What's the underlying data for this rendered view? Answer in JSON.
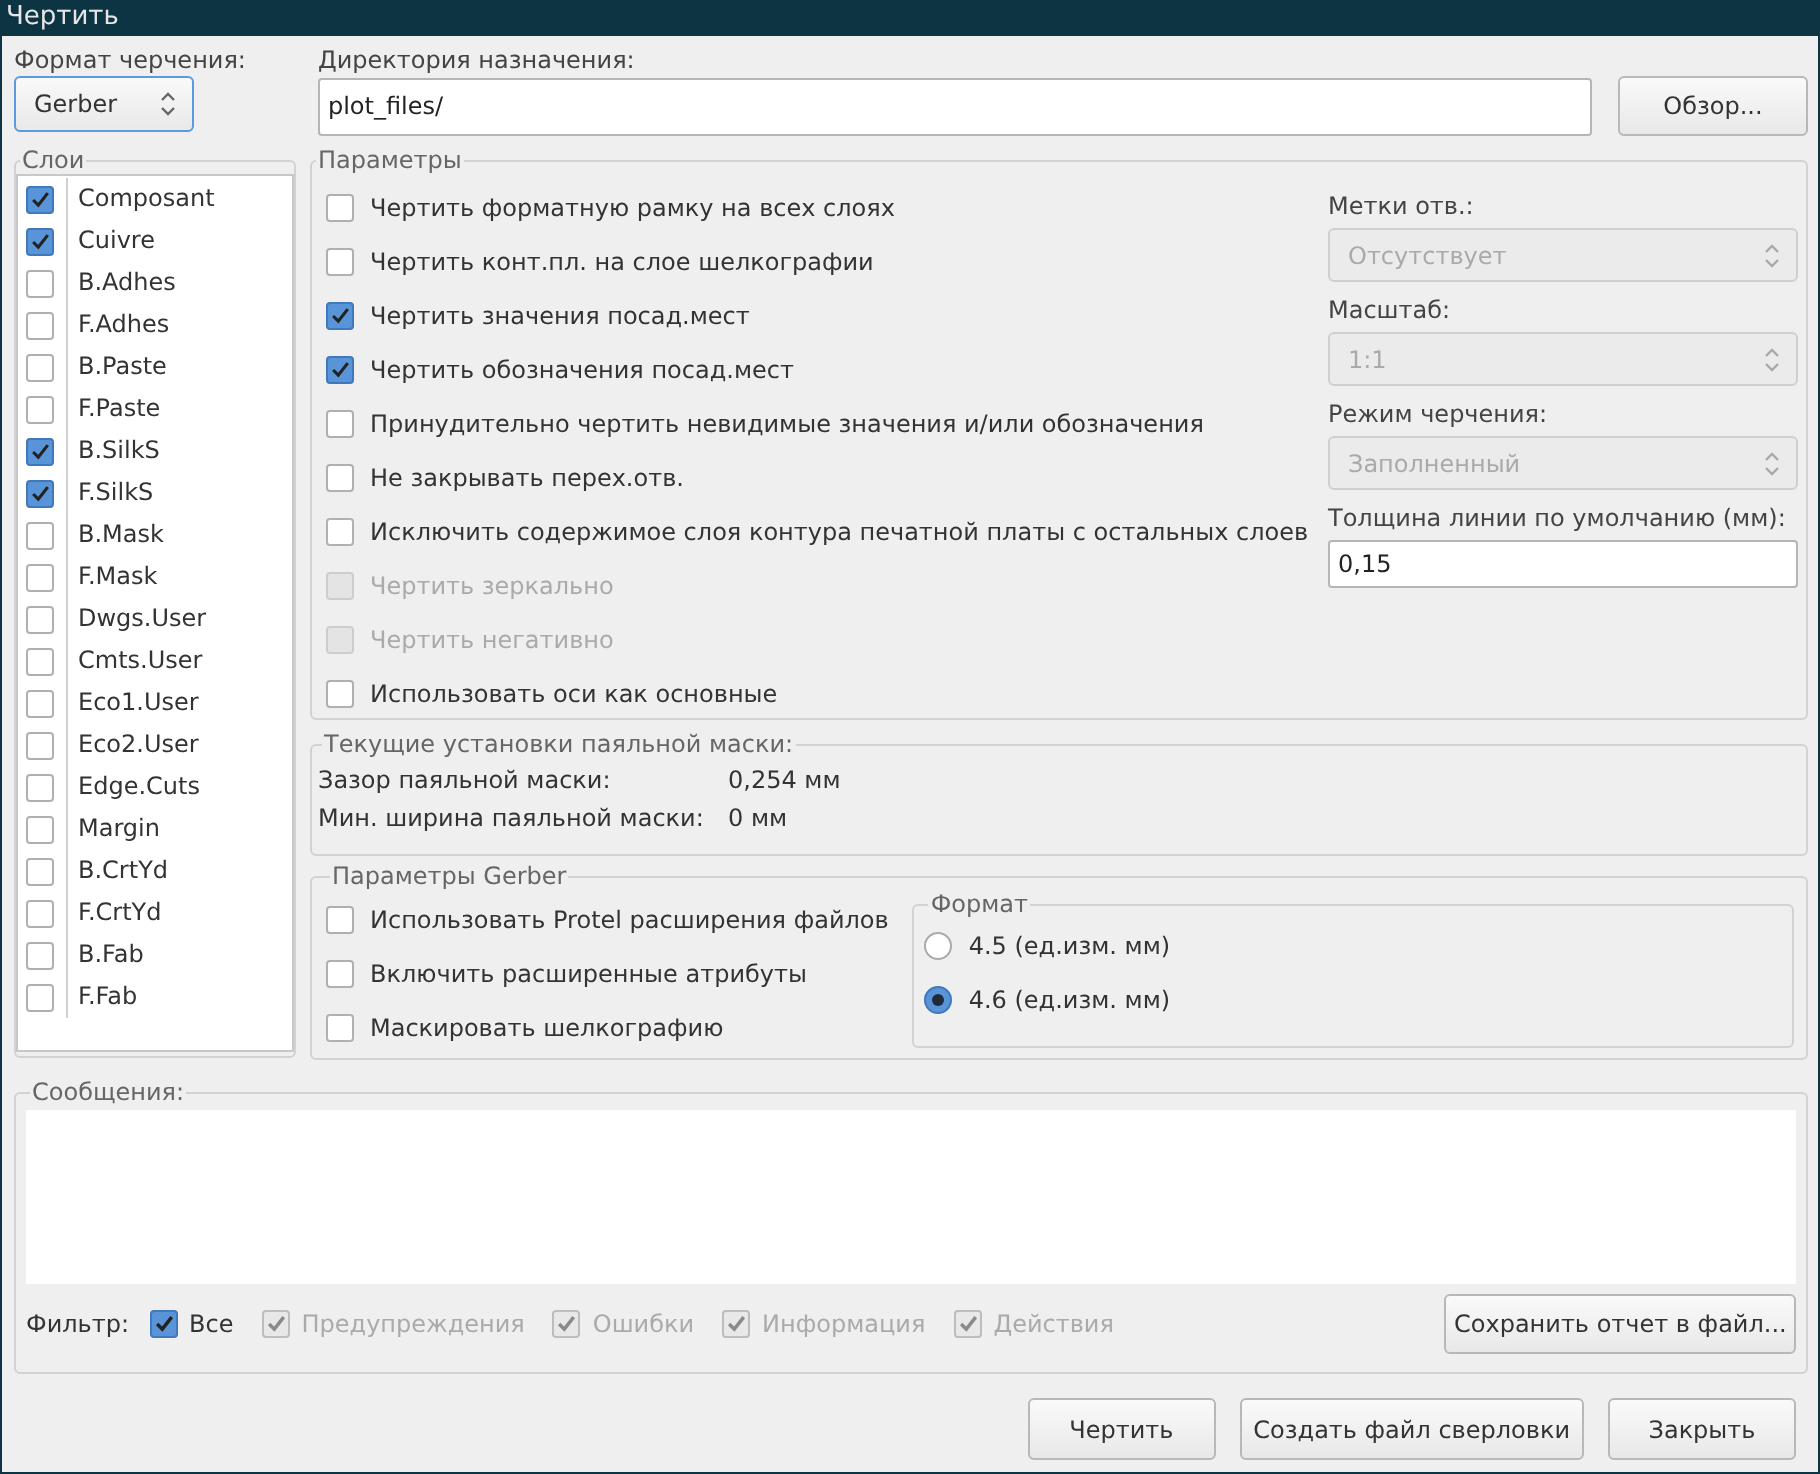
{
  "window": {
    "title": "Чертить"
  },
  "plot_format": {
    "label": "Формат черчения:",
    "value": "Gerber"
  },
  "output_directory": {
    "label": "Директория назначения:",
    "value": "plot_files/",
    "browse_button": "Обзор..."
  },
  "layers": {
    "title": "Слои",
    "items": [
      {
        "name": "Composant",
        "checked": true
      },
      {
        "name": "Cuivre",
        "checked": true
      },
      {
        "name": "B.Adhes",
        "checked": false
      },
      {
        "name": "F.Adhes",
        "checked": false
      },
      {
        "name": "B.Paste",
        "checked": false
      },
      {
        "name": "F.Paste",
        "checked": false
      },
      {
        "name": "B.SilkS",
        "checked": true
      },
      {
        "name": "F.SilkS",
        "checked": true
      },
      {
        "name": "B.Mask",
        "checked": false
      },
      {
        "name": "F.Mask",
        "checked": false
      },
      {
        "name": "Dwgs.User",
        "checked": false
      },
      {
        "name": "Cmts.User",
        "checked": false
      },
      {
        "name": "Eco1.User",
        "checked": false
      },
      {
        "name": "Eco2.User",
        "checked": false
      },
      {
        "name": "Edge.Cuts",
        "checked": false
      },
      {
        "name": "Margin",
        "checked": false
      },
      {
        "name": "B.CrtYd",
        "checked": false
      },
      {
        "name": "F.CrtYd",
        "checked": false
      },
      {
        "name": "B.Fab",
        "checked": false
      },
      {
        "name": "F.Fab",
        "checked": false
      }
    ]
  },
  "options": {
    "title": "Параметры",
    "checkboxes": [
      {
        "label": "Чертить форматную рамку на всех слоях",
        "checked": false,
        "disabled": false
      },
      {
        "label": "Чертить конт.пл. на слое шелкографии",
        "checked": false,
        "disabled": false
      },
      {
        "label": "Чертить значения посад.мест",
        "checked": true,
        "disabled": false
      },
      {
        "label": "Чертить обозначения посад.мест",
        "checked": true,
        "disabled": false
      },
      {
        "label": "Принудительно чертить  невидимые значения и/или обозначения",
        "checked": false,
        "disabled": false
      },
      {
        "label": "Не закрывать перех.отв.",
        "checked": false,
        "disabled": false
      },
      {
        "label": "Исключить содержимое слоя контура печатной платы с остальных слоев",
        "checked": false,
        "disabled": false
      },
      {
        "label": "Чертить зеркально",
        "checked": false,
        "disabled": true
      },
      {
        "label": "Чертить негативно",
        "checked": false,
        "disabled": true
      },
      {
        "label": "Использовать оси как основные",
        "checked": false,
        "disabled": false
      }
    ],
    "drill_marks": {
      "label": "Метки отв.:",
      "value": "Отсутствует",
      "disabled": true
    },
    "scale": {
      "label": "Масштаб:",
      "value": "1:1",
      "disabled": true
    },
    "plot_mode": {
      "label": "Режим черчения:",
      "value": "Заполненный",
      "disabled": true
    },
    "line_width": {
      "label": "Толщина линии по умолчанию (мм):",
      "value": "0,15"
    }
  },
  "solder_mask": {
    "title": "Текущие установки паяльной маски:",
    "rows": [
      {
        "label": "Зазор паяльной маски:",
        "value": "0,254 мм"
      },
      {
        "label": "Мин. ширина паяльной маски:",
        "value": "0 мм"
      }
    ]
  },
  "gerber_options": {
    "title": "Параметры Gerber",
    "checkboxes": [
      {
        "label": "Использовать Protel расширения файлов",
        "checked": false
      },
      {
        "label": "Включить расширенные атрибуты",
        "checked": false
      },
      {
        "label": "Маскировать шелкографию",
        "checked": false
      }
    ],
    "format": {
      "title": "Формат",
      "options": [
        {
          "label": "4.5 (ед.изм. мм)",
          "selected": false
        },
        {
          "label": "4.6 (ед.изм. мм)",
          "selected": true
        }
      ]
    }
  },
  "messages": {
    "title": "Сообщения:",
    "filter_label": "Фильтр:",
    "filters": [
      {
        "label": "Все",
        "checked": true,
        "disabled": false
      },
      {
        "label": "Предупреждения",
        "checked": true,
        "disabled": true
      },
      {
        "label": "Ошибки",
        "checked": true,
        "disabled": true
      },
      {
        "label": "Информация",
        "checked": true,
        "disabled": true
      },
      {
        "label": "Действия",
        "checked": true,
        "disabled": true
      }
    ],
    "save_button": "Сохранить отчет в файл..."
  },
  "buttons": [
    "Чертить",
    "Создать файл сверловки",
    "Закрыть"
  ]
}
